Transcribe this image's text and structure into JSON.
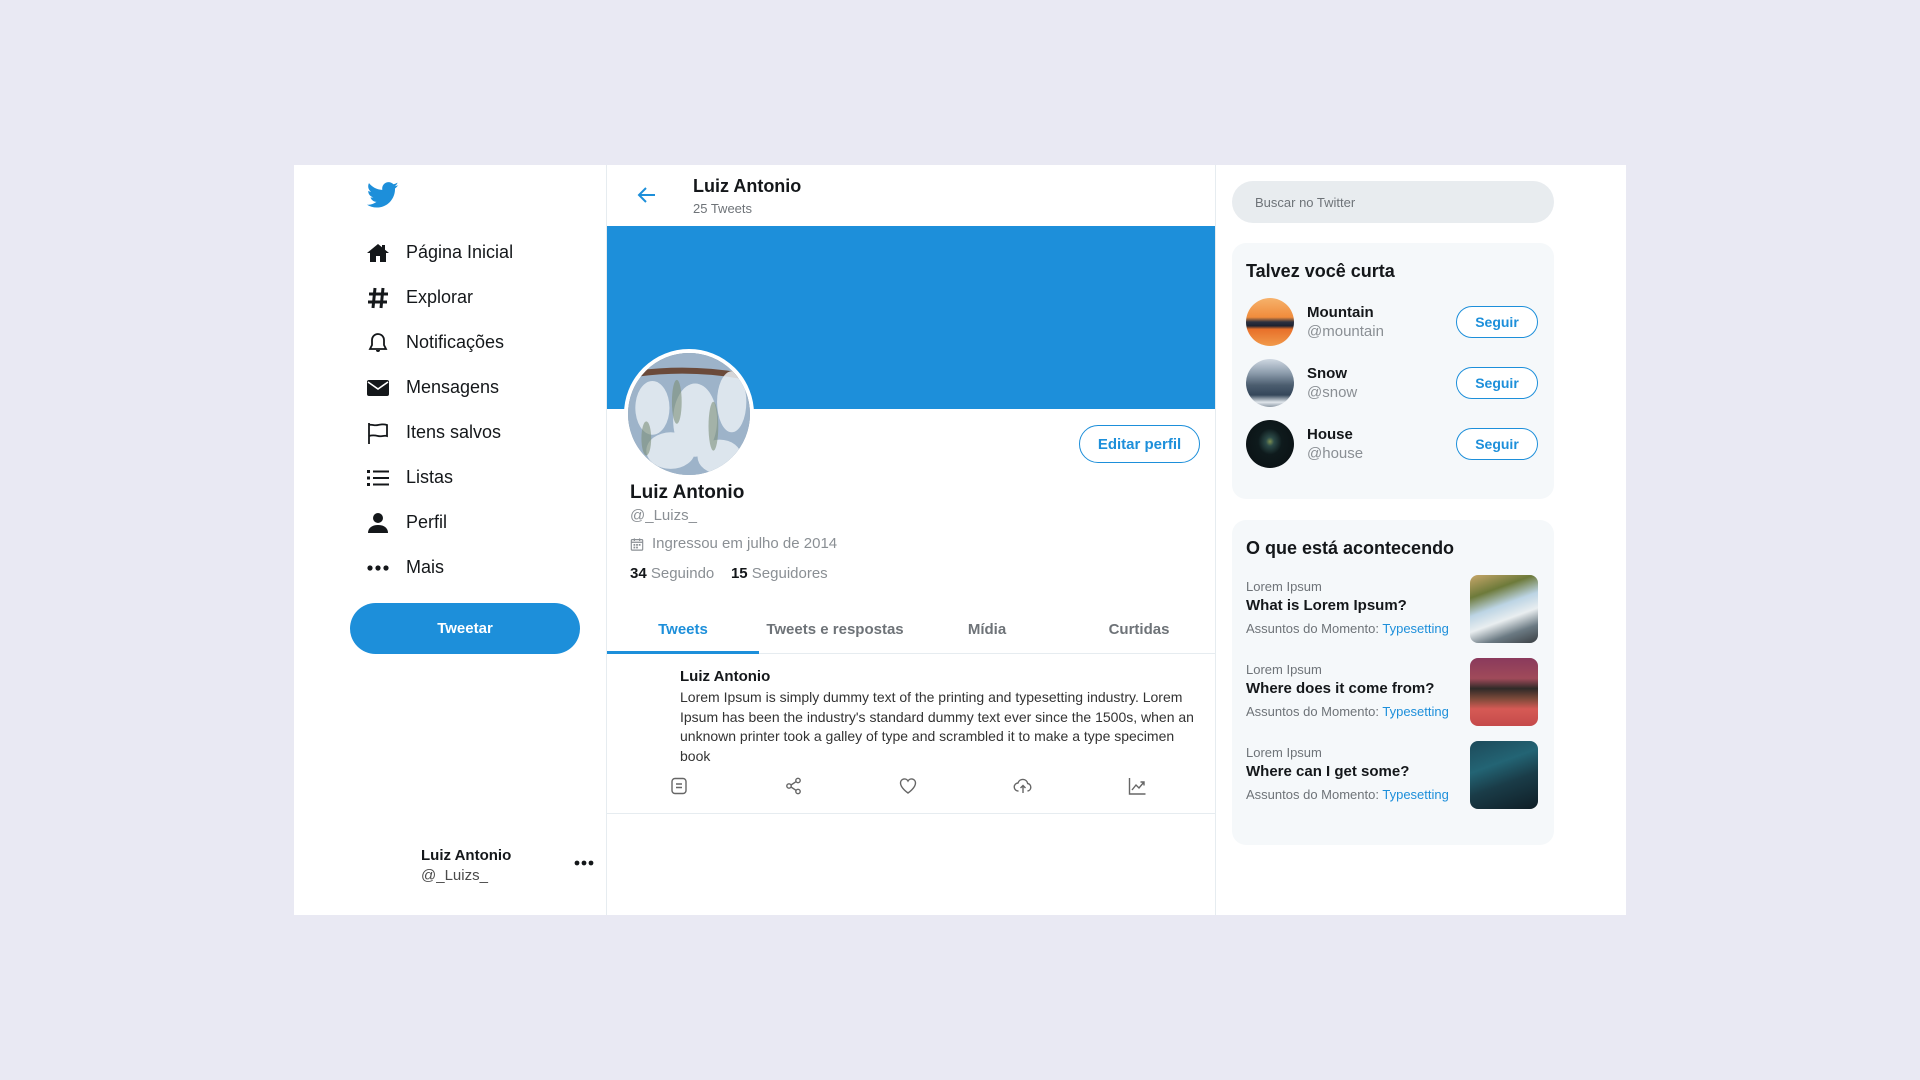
{
  "colors": {
    "accent": "#1d8fda",
    "background": "#e9e9f3",
    "panel": "#ffffff"
  },
  "sidebar": {
    "logo": "twitter-bird-icon",
    "items": [
      {
        "label": "Página Inicial",
        "icon": "home-icon"
      },
      {
        "label": "Explorar",
        "icon": "hashtag-icon"
      },
      {
        "label": "Notificações",
        "icon": "bell-icon"
      },
      {
        "label": "Mensagens",
        "icon": "envelope-icon"
      },
      {
        "label": "Itens salvos",
        "icon": "flag-icon"
      },
      {
        "label": "Listas",
        "icon": "list-icon"
      },
      {
        "label": "Perfil",
        "icon": "user-icon"
      },
      {
        "label": "Mais",
        "icon": "more-icon"
      }
    ],
    "tweet_button": "Tweetar",
    "account": {
      "name": "Luiz Antonio",
      "handle": "@_Luizs_"
    }
  },
  "header": {
    "title": "Luiz Antonio",
    "subtitle": "25 Tweets"
  },
  "profile": {
    "name": "Luiz Antonio",
    "handle": "@_Luizs_",
    "joined": "Ingressou em julho de 2014",
    "following_count": "34",
    "following_label": "Seguindo",
    "followers_count": "15",
    "followers_label": "Seguidores",
    "edit_button": "Editar perfil"
  },
  "tabs": [
    {
      "label": "Tweets",
      "active": true
    },
    {
      "label": "Tweets e respostas",
      "active": false
    },
    {
      "label": "Mídia",
      "active": false
    },
    {
      "label": "Curtidas",
      "active": false
    }
  ],
  "tweets": [
    {
      "author": "Luiz Antonio",
      "text": "Lorem Ipsum is simply dummy text of the printing and typesetting industry. Lorem Ipsum has been the industry's standard dummy text ever since the 1500s, when an unknown printer took a galley of type and scrambled it to make a type specimen book"
    }
  ],
  "search": {
    "placeholder": "Buscar no Twitter"
  },
  "who_to_follow": {
    "title": "Talvez você curta",
    "users": [
      {
        "name": "Mountain",
        "handle": "@mountain",
        "button": "Seguir"
      },
      {
        "name": "Snow",
        "handle": "@snow",
        "button": "Seguir"
      },
      {
        "name": "House",
        "handle": "@house",
        "button": "Seguir"
      }
    ]
  },
  "trends": {
    "title": "O que está acontecendo",
    "items": [
      {
        "category": "Lorem Ipsum",
        "title": "What is Lorem Ipsum?",
        "meta_label": "Assuntos do Momento:",
        "meta_link": "Typesetting"
      },
      {
        "category": "Lorem Ipsum",
        "title": "Where does it come from?",
        "meta_label": "Assuntos do Momento:",
        "meta_link": "Typesetting"
      },
      {
        "category": "Lorem Ipsum",
        "title": "Where can I get some?",
        "meta_label": "Assuntos do Momento:",
        "meta_link": "Typesetting"
      }
    ]
  }
}
